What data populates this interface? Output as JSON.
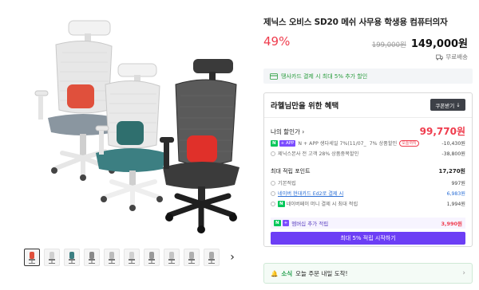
{
  "product": {
    "title": "제닉스 오비스 SD20 메쉬 사무용 학생용 컴퓨터의자",
    "discount_rate": "49%",
    "original_price": "199,000원",
    "sale_price": "149,000원",
    "shipping": "무료배송"
  },
  "card_banner": {
    "text": "땡사카드 결제 시 최대 5% 추가 할인",
    "icon": "card-icon"
  },
  "benefits": {
    "title": "라헬님만을 위한 혜택",
    "coupon_button": "쿠폰받기",
    "my_price_label": "나의 할인가",
    "my_price": "99,770원",
    "discounts": [
      {
        "label": "N + APP 생다세일 7%(11/07_",
        "extra": "7% 상품할인",
        "tag": "오늘까지",
        "amount": "-10,430원"
      },
      {
        "label": "제닉스본사 전 고객 28% 상품중복할인",
        "amount": "-38,800원"
      }
    ],
    "points_title": "최대 적립 포인트",
    "points_total": "17,270원",
    "points": [
      {
        "label": "기본적립",
        "amount": "997원"
      },
      {
        "label": "네이버 현대카드 Ed2로 결제 시",
        "amount": "6,983원"
      },
      {
        "label": "네이버페이 머니 결제 시 최대 적립",
        "amount": "1,994원"
      }
    ],
    "membership": {
      "label": "멤버십 추가 적립",
      "amount": "3,990원"
    },
    "signup_button": "최대 5% 적립 시작하기"
  },
  "delivery": {
    "badge": "소식",
    "text": "오늘 주문 내일 도착!"
  },
  "gallery": {
    "thumb_count": 10,
    "next_label": "›"
  },
  "colors": {
    "accent_red": "#ef3c4d",
    "naver_green": "#03c75a",
    "membership_purple": "#6c3ef5"
  }
}
